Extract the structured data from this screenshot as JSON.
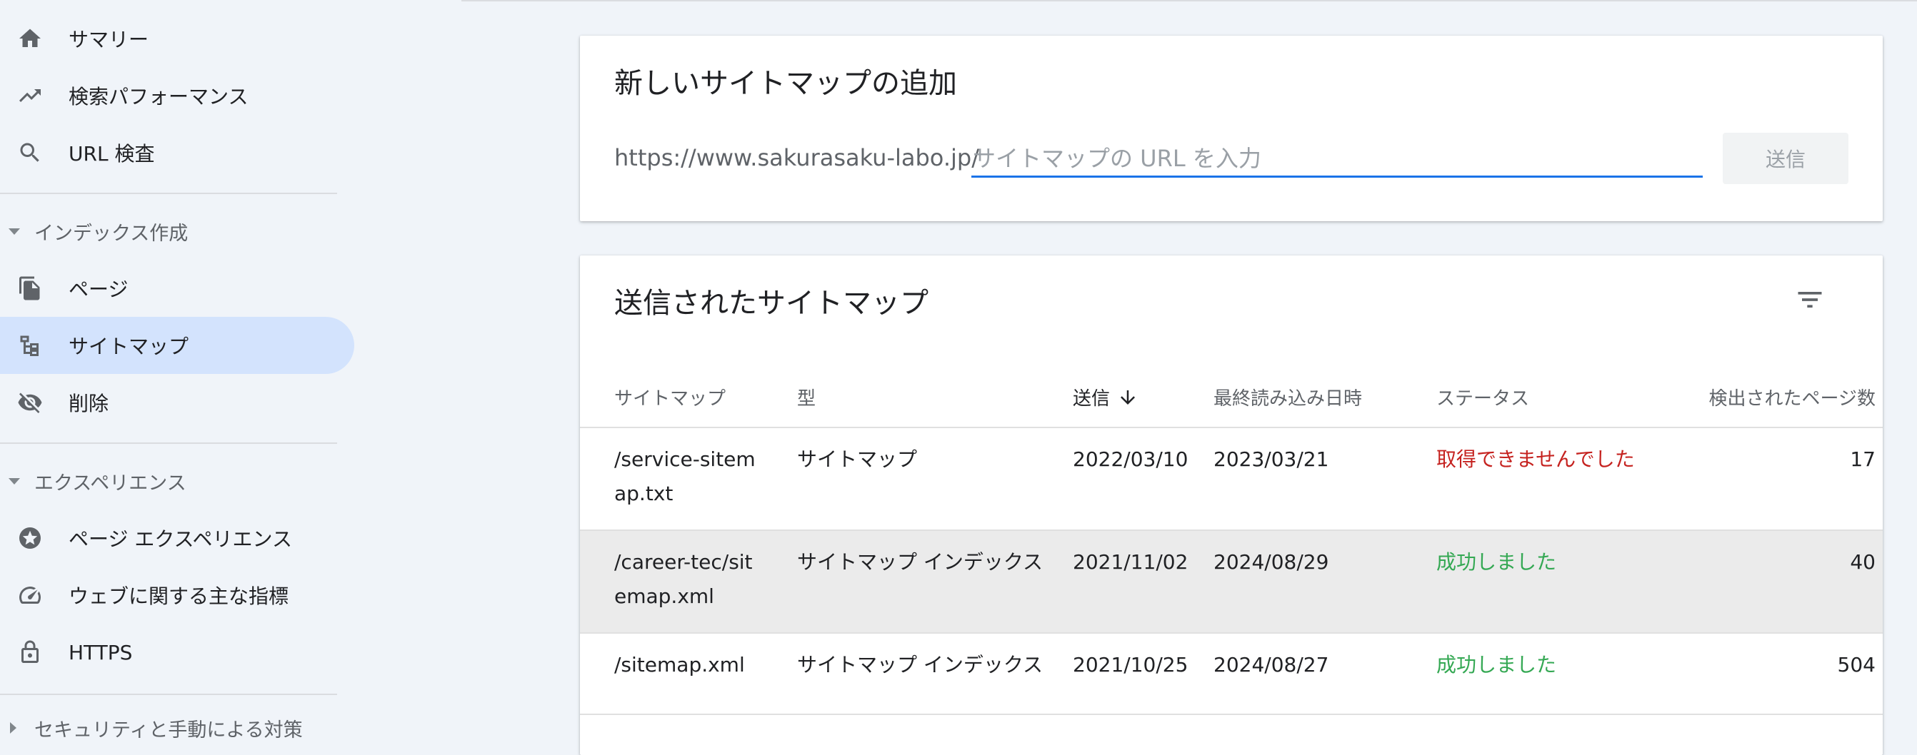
{
  "sidebar": {
    "items": [
      {
        "label": "サマリー",
        "icon": "home-icon"
      },
      {
        "label": "検索パフォーマンス",
        "icon": "trending-up-icon"
      },
      {
        "label": "URL 検査",
        "icon": "search-icon"
      }
    ],
    "sections": [
      {
        "title": "インデックス作成",
        "items": [
          {
            "label": "ページ",
            "icon": "file-copy-icon"
          },
          {
            "label": "サイトマップ",
            "icon": "sitemap-icon",
            "active": true
          },
          {
            "label": "削除",
            "icon": "visibility-off-icon"
          }
        ]
      },
      {
        "title": "エクスペリエンス",
        "items": [
          {
            "label": "ページ エクスペリエンス",
            "icon": "experience-icon"
          },
          {
            "label": "ウェブに関する主な指標",
            "icon": "speed-icon"
          },
          {
            "label": "HTTPS",
            "icon": "lock-icon"
          }
        ]
      },
      {
        "title": "セキュリティと手動による対策"
      }
    ]
  },
  "add_sitemap": {
    "title": "新しいサイトマップの追加",
    "url_prefix": "https://www.sakurasaku-labo.jp/",
    "input_value": "",
    "input_placeholder": "サイトマップの URL を入力",
    "submit_label": "送信"
  },
  "submitted": {
    "title": "送信されたサイトマップ",
    "columns": {
      "sitemap": "サイトマップ",
      "type": "型",
      "submitted": "送信",
      "last_read": "最終読み込み日時",
      "status": "ステータス",
      "pages": "検出されたページ数"
    },
    "rows": [
      {
        "sitemap": "/service-sitemap.txt",
        "type": "サイトマップ",
        "submitted": "2022/03/10",
        "last_read": "2023/03/21",
        "status": "取得できませんでした",
        "status_kind": "error",
        "pages": "17"
      },
      {
        "sitemap": "/career-tec/sitemap.xml",
        "type": "サイトマップ インデックス",
        "submitted": "2021/11/02",
        "last_read": "2024/08/29",
        "status": "成功しました",
        "status_kind": "ok",
        "pages": "40"
      },
      {
        "sitemap": "/sitemap.xml",
        "type": "サイトマップ インデックス",
        "submitted": "2021/10/25",
        "last_read": "2024/08/27",
        "status": "成功しました",
        "status_kind": "ok",
        "pages": "504"
      }
    ]
  },
  "colors": {
    "active_nav": "#d3e3fd",
    "accent": "#1a73e8",
    "status_error": "#c5221f",
    "status_ok": "#34a853"
  }
}
